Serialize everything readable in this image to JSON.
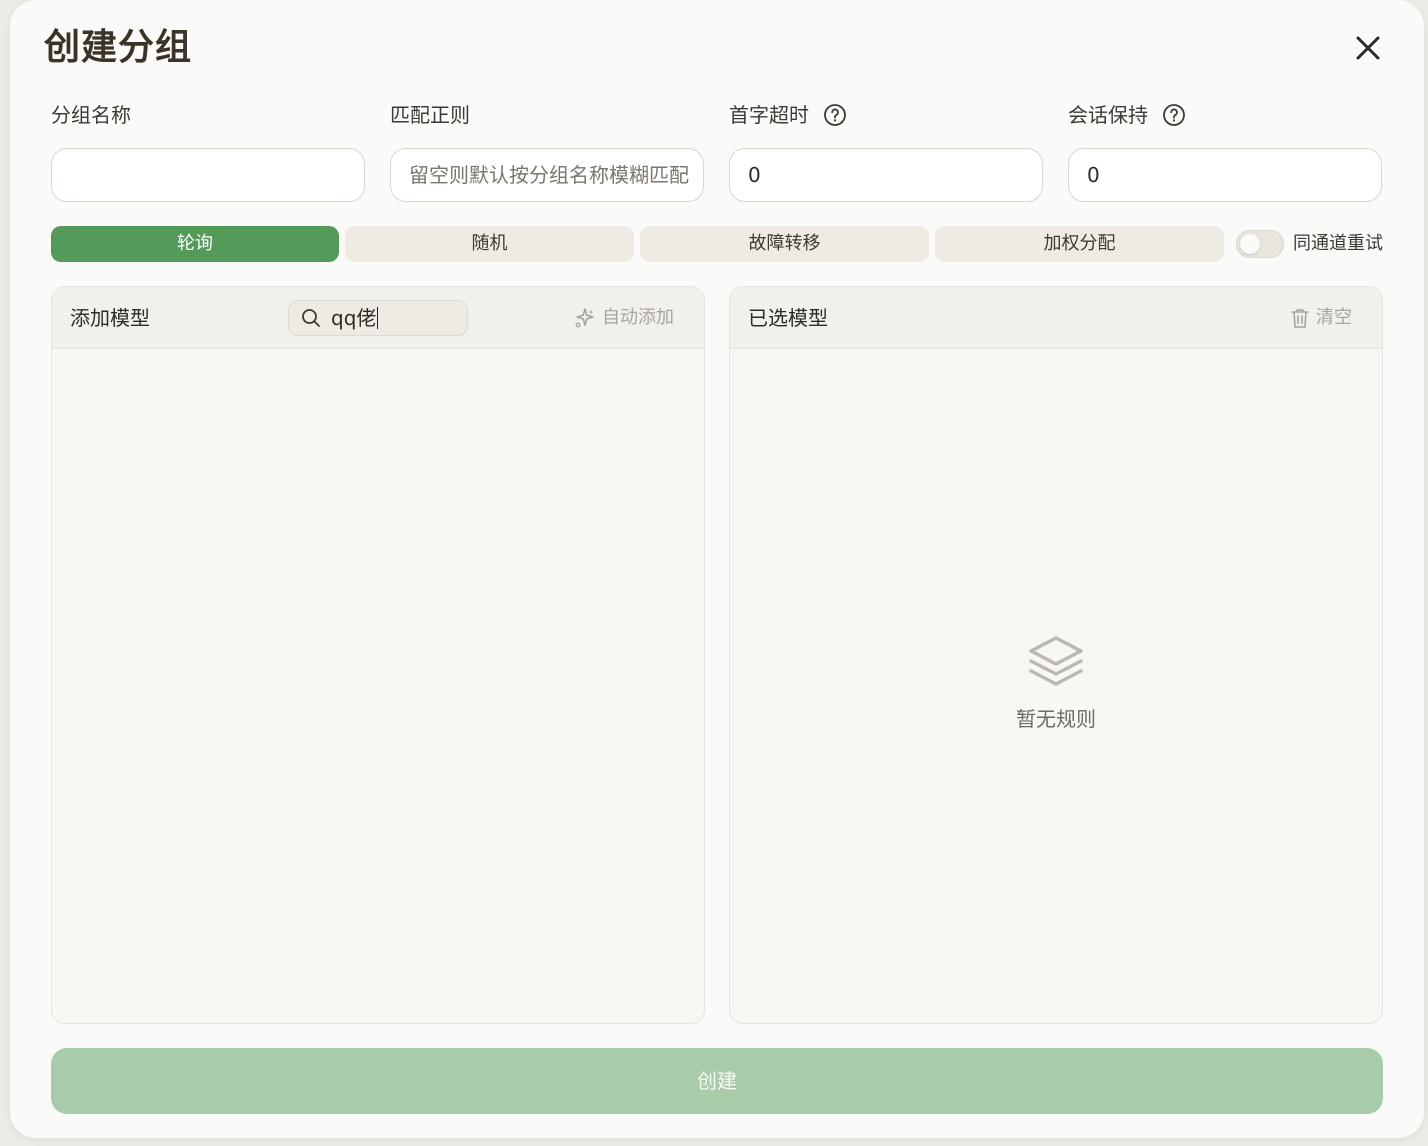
{
  "dialog": {
    "title": "创建分组",
    "close_icon": "close-icon"
  },
  "fields": {
    "group_name": {
      "label": "分组名称",
      "value": "",
      "placeholder": ""
    },
    "match_regex": {
      "label": "匹配正则",
      "value": "",
      "placeholder": "留空则默认按分组名称模糊匹配"
    },
    "first_token_timeout": {
      "label": "首字超时",
      "value": "0",
      "help_icon": "question-circle-icon"
    },
    "session_keep": {
      "label": "会话保持",
      "value": "0",
      "help_icon": "question-circle-icon"
    }
  },
  "modes": {
    "selected": "轮询",
    "items": [
      {
        "label": "轮询",
        "active": true
      },
      {
        "label": "随机",
        "active": false
      },
      {
        "label": "故障转移",
        "active": false
      },
      {
        "label": "加权分配",
        "active": false
      }
    ]
  },
  "retry_toggle": {
    "label": "同通道重试",
    "on": false
  },
  "add_panel": {
    "title": "添加模型",
    "search_value": "qq佬",
    "search_icon": "search-icon",
    "auto_add_label": "自动添加",
    "auto_add_icon": "sparkles-icon"
  },
  "selected_panel": {
    "title": "已选模型",
    "clear_label": "清空",
    "clear_icon": "trash-icon",
    "empty_icon": "layers-icon",
    "empty_text": "暂无规则"
  },
  "footer": {
    "create_label": "创建"
  },
  "colors": {
    "accent": "#549a58",
    "accent_disabled": "#a8cbaa",
    "title_text": "#3b3326",
    "muted_text": "#a8a49c"
  }
}
